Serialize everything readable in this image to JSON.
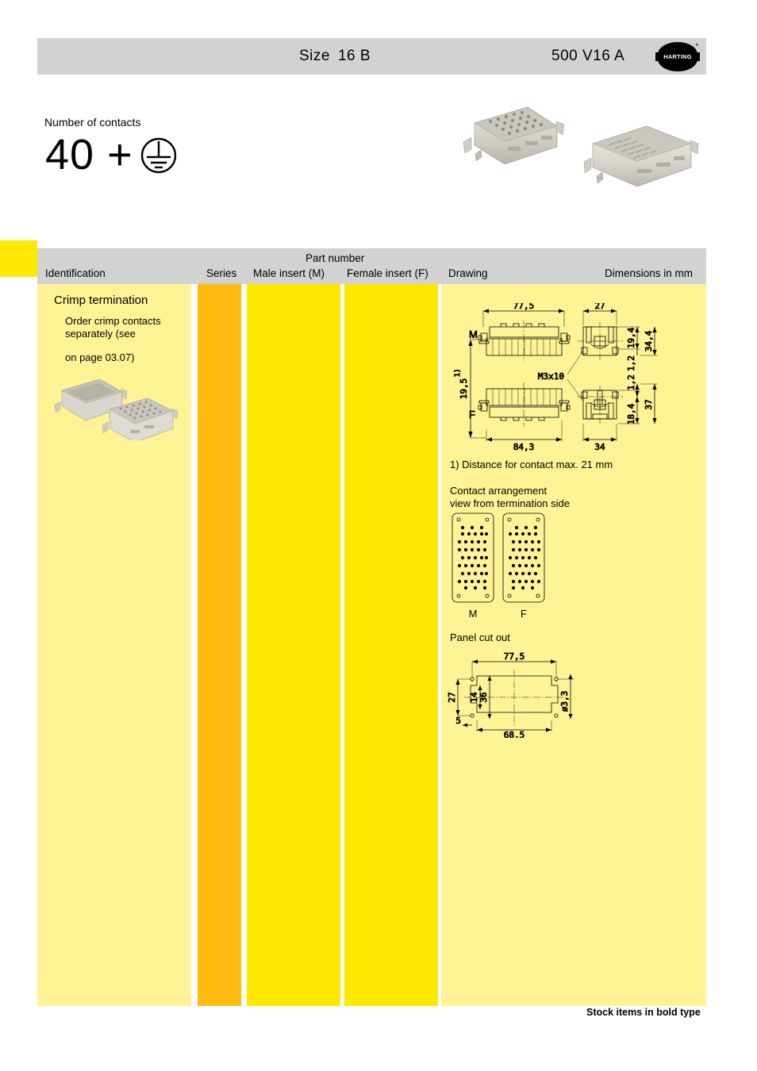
{
  "header": {
    "size_label": "Size",
    "size_value": "16 B",
    "voltage": "500 V",
    "current": "16 A",
    "brand": "HARTING"
  },
  "contacts": {
    "label": "Number of contacts",
    "value": "40 +",
    "earth_symbol": "protective-earth"
  },
  "table": {
    "headers": {
      "identification": "Identification",
      "series": "Series",
      "part_number": "Part number",
      "male_insert": "Male insert (M)",
      "female_insert": "Female insert (F)",
      "drawing": "Drawing",
      "dimensions": "Dimensions in mm"
    },
    "row": {
      "identification_title": "Crimp termination",
      "identification_note_line1": "Order crimp contacts",
      "identification_note_line2": "separately (see",
      "identification_note_line3": "on page 03.07)",
      "series": "",
      "male_part_number": "",
      "female_part_number": ""
    }
  },
  "drawing": {
    "main_view": {
      "male_label": "M",
      "female_label": "F",
      "width_top": "77,5",
      "width_bottom": "84,3",
      "height_left": "19,5",
      "height_left_footnote": "1)",
      "side_width_top": "27",
      "side_width_bottom": "34",
      "side_h1": "19,4",
      "side_h2": "34,4",
      "side_h3": "1,2",
      "side_h4": "1,2",
      "side_h5": "18,4",
      "side_h6": "37",
      "screw": "M3x10"
    },
    "footnote": "1) Distance for contact max. 21 mm",
    "arrangement_label_line1": "Contact arrangement",
    "arrangement_label_line2": "view from termination side",
    "arrangement_male_label": "M",
    "arrangement_female_label": "F",
    "panel_cutout_label": "Panel cut out",
    "panel_cutout": {
      "width_top": "77,5",
      "width_bottom": "68,5",
      "height_left": "27",
      "inner_height": "14",
      "outer_height": "36",
      "corner_offset": "5",
      "hole_diameter": "ø3,3"
    }
  },
  "footer": {
    "note": "Stock items in bold type"
  },
  "colors": {
    "header_grey": "#d2d2d2",
    "column_light_yellow": "#fff396",
    "column_yellow": "#ffe800",
    "column_orange": "#ffba12",
    "index_tab": "#ffe800"
  }
}
